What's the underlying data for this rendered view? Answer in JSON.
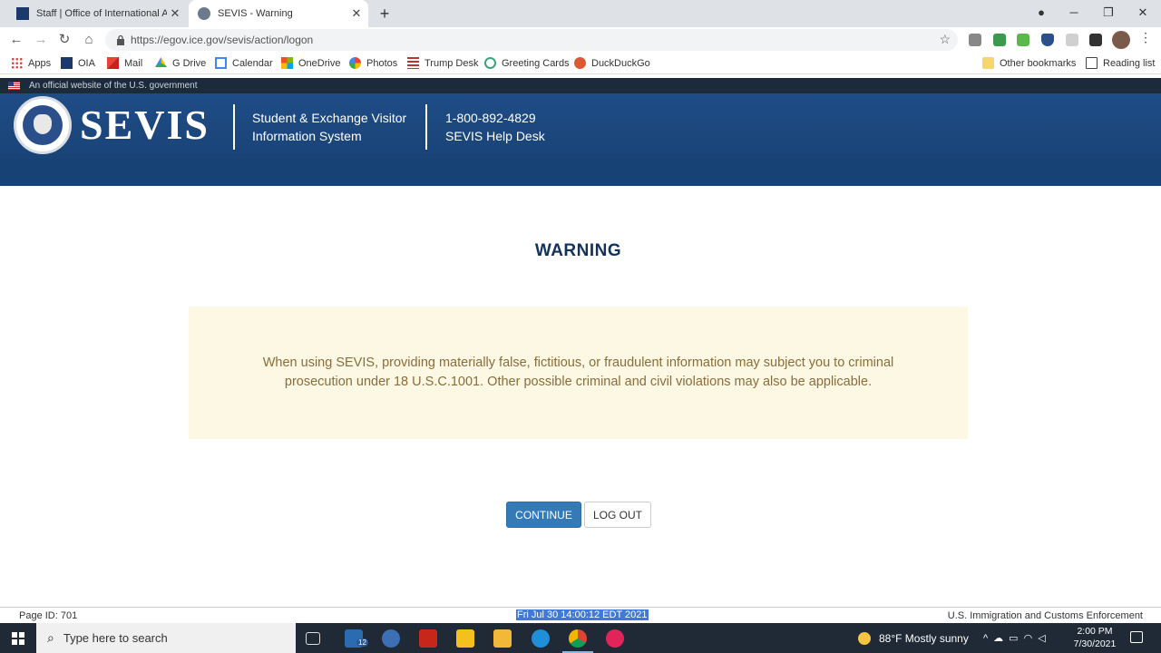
{
  "browser": {
    "tabs": [
      {
        "title": "Staff | Office of International Affa",
        "active": false
      },
      {
        "title": "SEVIS - Warning",
        "active": true
      }
    ],
    "url": "https://egov.ice.gov/sevis/action/logon",
    "bookmarks": [
      "Apps",
      "OIA",
      "Mail",
      "G Drive",
      "Calendar",
      "OneDrive",
      "Photos",
      "Trump Desk",
      "Greeting Cards",
      "DuckDuckGo"
    ],
    "other_bookmarks": "Other bookmarks",
    "reading_list": "Reading list"
  },
  "gov_banner": "An official website of the U.S. government",
  "header": {
    "logo": "SEVIS",
    "system_line1": "Student & Exchange Visitor",
    "system_line2": "Information System",
    "phone": "1-800-892-4829",
    "help_desk": "SEVIS Help Desk"
  },
  "main": {
    "title": "WARNING",
    "warning_text": "When using SEVIS, providing materially false, fictitious, or fraudulent information may subject you to criminal prosecution under 18 U.S.C.1001. Other possible criminal and civil violations may also be applicable.",
    "continue_label": "CONTINUE",
    "logout_label": "LOG OUT"
  },
  "footer": {
    "page_id": "Page ID: 701",
    "timestamp": "Fri Jul 30 14:00:12 EDT 2021",
    "agency": "U.S. Immigration and Customs Enforcement"
  },
  "taskbar": {
    "search_placeholder": "Type here to search",
    "mail_badge": "12",
    "weather": "88°F  Mostly sunny",
    "time": "2:00 PM",
    "date": "7/30/2021"
  },
  "colors": {
    "header_blue": "#1a4478",
    "title_navy": "#12325c",
    "warning_bg": "#fcf8e3",
    "warning_text": "#8a6d3b",
    "primary_button": "#337ab7"
  }
}
